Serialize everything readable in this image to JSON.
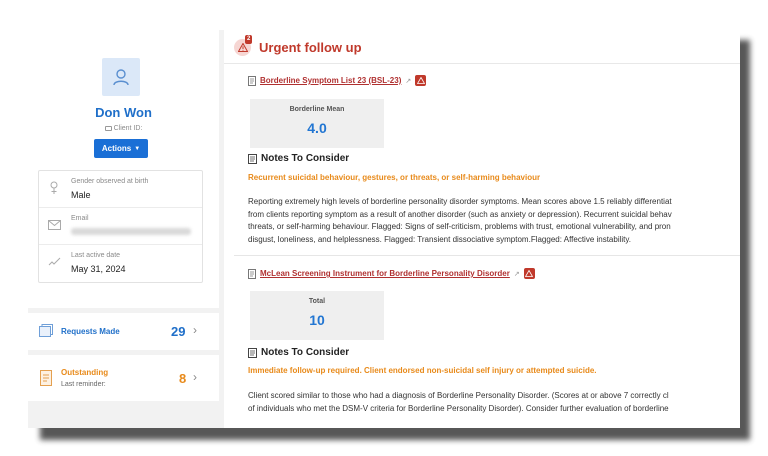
{
  "client": {
    "name": "Don Won",
    "client_id_label": "Client ID:",
    "actions_label": "Actions",
    "gender_label": "Gender observed at birth",
    "gender_value": "Male",
    "email_label": "Email",
    "last_active_label": "Last active date",
    "last_active_value": "May 31, 2024"
  },
  "sidebar": {
    "requests_label": "Requests Made",
    "requests_count": "29",
    "outstanding_label": "Outstanding",
    "outstanding_sub": "Last reminder:",
    "outstanding_count": "8"
  },
  "urgent": {
    "title": "Urgent follow up",
    "badge": "2"
  },
  "assessments": [
    {
      "title": "Borderline Symptom List 23 (BSL-23)",
      "score_label": "Borderline Mean",
      "score_value": "4.0",
      "notes_title": "Notes To Consider",
      "flag": "Recurrent suicidal behaviour, gestures, or threats, or self-harming behaviour",
      "lines": [
        "Reporting extremely high levels of borderline personality disorder symptoms. Mean scores above 1.5 reliably differentiat",
        "from clients reporting symptom as a result of another disorder (such as anxiety or depression). Recurrent suicidal behav",
        "threats, or self-harming behaviour. Flagged: Signs of self-criticism, problems with trust, emotional vulnerability, and pron",
        "disgust, loneliness, and helplessness. Flagged: Transient dissociative symptom.Flagged: Affective instability."
      ]
    },
    {
      "title": "McLean Screening Instrument for Borderline Personality Disorder",
      "score_label": "Total",
      "score_value": "10",
      "notes_title": "Notes To Consider",
      "flag": "Immediate follow-up required. Client endorsed non-suicidal self injury or attempted suicide.",
      "lines": [
        "Client scored similar to those who had a diagnosis of Borderline Personality Disorder. (Scores at or above 7 correctly cl",
        "of individuals who met the DSM-V criteria for Borderline Personality Disorder). Consider further evaluation of borderline"
      ]
    }
  ],
  "colors": {
    "accent_blue": "#1a6fd6",
    "urgent_red": "#c0392b",
    "flag_orange": "#e88a1a"
  },
  "icons": [
    "user-icon",
    "id-card-icon",
    "gender-icon",
    "mail-icon",
    "activity-icon",
    "requests-icon",
    "outstanding-icon",
    "alert-icon",
    "document-icon",
    "external-link-icon",
    "warning-icon",
    "notes-icon",
    "chevron-right-icon",
    "caret-down-icon"
  ]
}
